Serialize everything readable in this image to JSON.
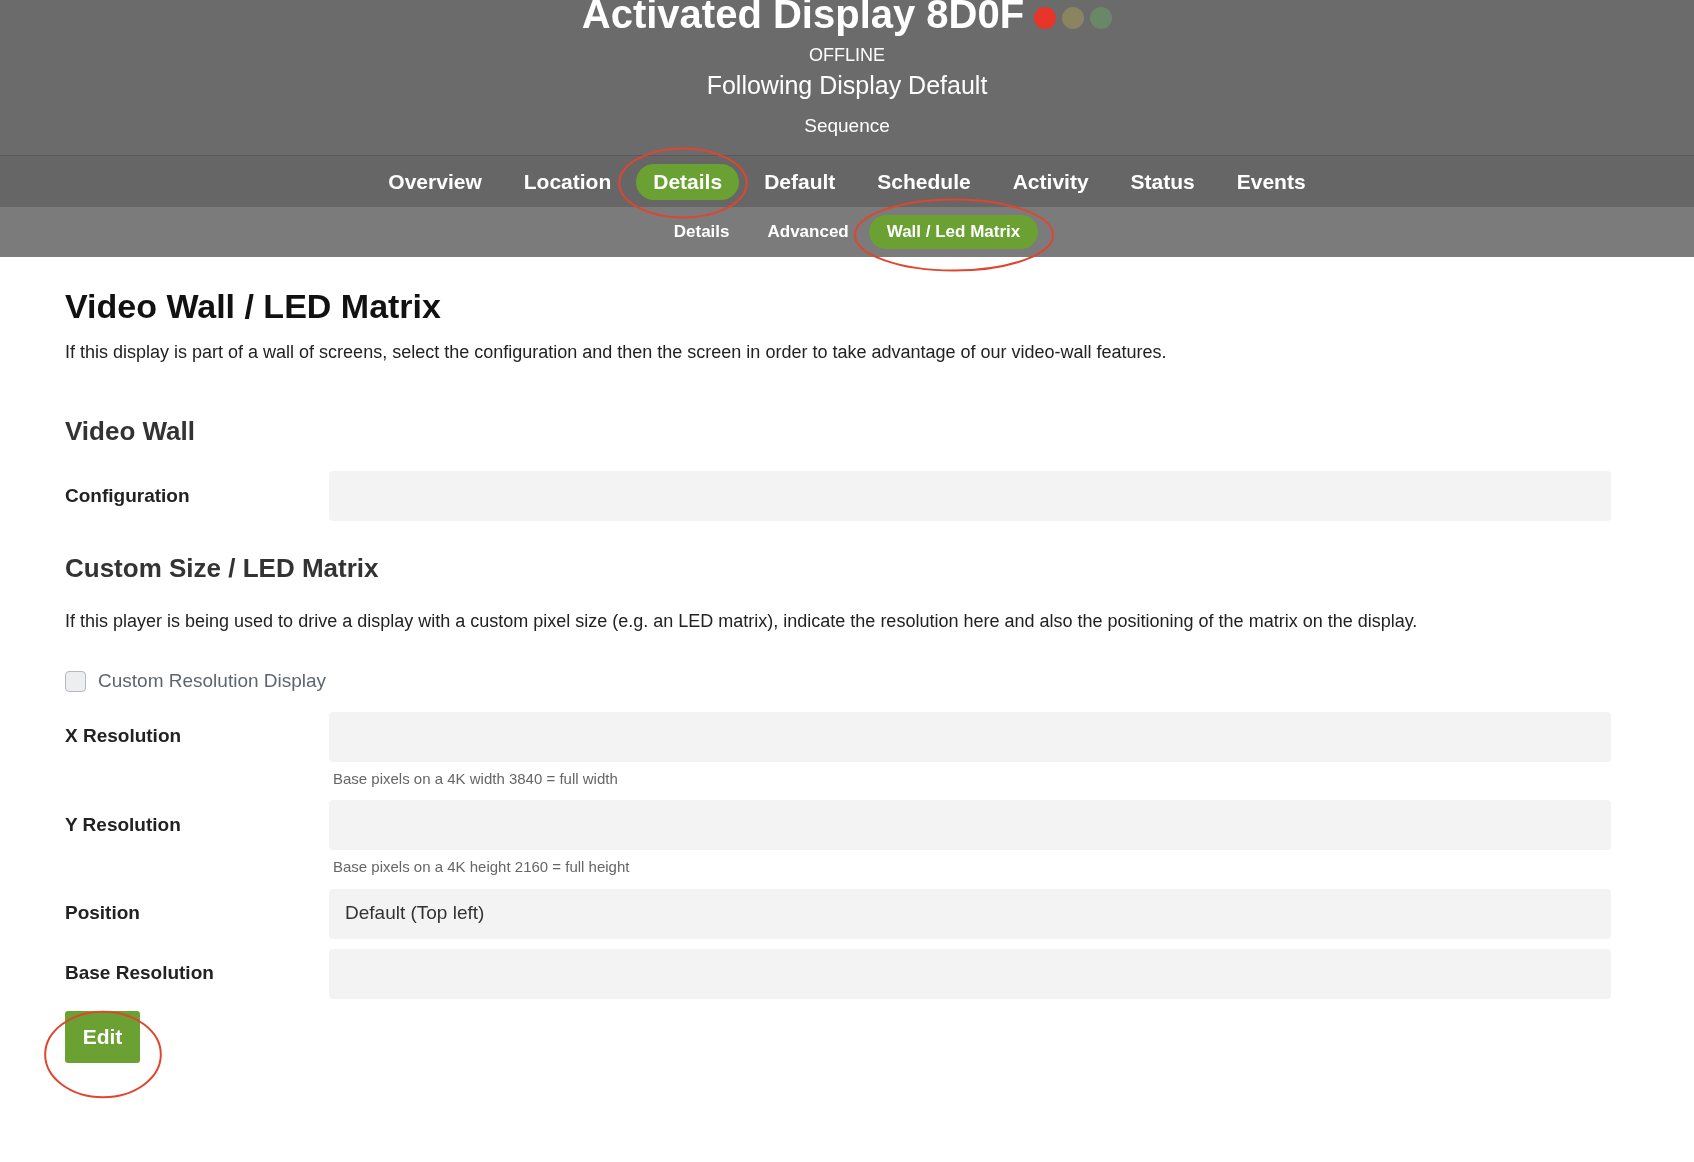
{
  "header": {
    "title": "Activated Display 8D0F",
    "status_lights": [
      {
        "color": "#e8352a"
      },
      {
        "color": "#8a8460"
      },
      {
        "color": "#6a8868"
      }
    ],
    "status": "OFFLINE",
    "mode": "Following Display Default",
    "content": "Sequence"
  },
  "tabs": [
    {
      "label": "Overview",
      "selected": false
    },
    {
      "label": "Location",
      "selected": false
    },
    {
      "label": "Details",
      "selected": true
    },
    {
      "label": "Default",
      "selected": false
    },
    {
      "label": "Schedule",
      "selected": false
    },
    {
      "label": "Activity",
      "selected": false
    },
    {
      "label": "Status",
      "selected": false
    },
    {
      "label": "Events",
      "selected": false
    }
  ],
  "subtabs": [
    {
      "label": "Details",
      "selected": false
    },
    {
      "label": "Advanced",
      "selected": false
    },
    {
      "label": "Wall / Led Matrix",
      "selected": true
    }
  ],
  "page": {
    "title": "Video Wall / LED Matrix",
    "intro": "If this display is part of a wall of screens, select the configuration and then the screen in order to take advantage of our video-wall features."
  },
  "video_wall": {
    "title": "Video Wall",
    "fields": [
      {
        "label": "Configuration"
      }
    ]
  },
  "custom_size": {
    "title": "Custom Size / LED Matrix",
    "description": "If this player is being used to drive a display with a custom pixel size (e.g. an LED matrix), indicate the resolution here and also the positioning of the matrix on the display.",
    "checkbox": {
      "label": "Custom Resolution Display",
      "checked": false
    },
    "fields": [
      {
        "label": "X Resolution",
        "hint": "Base pixels on a 4K width 3840 = full width"
      },
      {
        "label": "Y Resolution",
        "hint": "Base pixels on a 4K height 2160 = full height"
      },
      {
        "label": "Position",
        "value": "Default (Top left)"
      },
      {
        "label": "Base Resolution"
      }
    ]
  },
  "edit_button": "Edit"
}
